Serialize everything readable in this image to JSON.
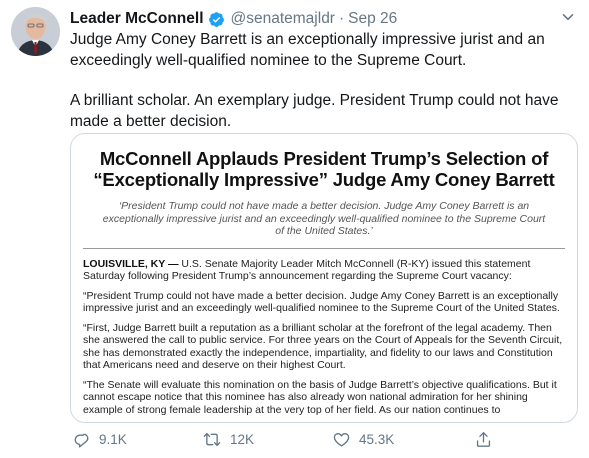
{
  "tweet": {
    "author_name": "Leader McConnell",
    "handle": "@senatemajldr",
    "separator": "·",
    "date": "Sep 26",
    "text_1": "Judge Amy Coney Barrett is an exceptionally impressive jurist and an exceedingly well-qualified nominee to the Supreme Court.",
    "text_2": "A brilliant scholar. An exemplary judge. President Trump could not have made a better decision."
  },
  "media": {
    "title": "McConnell Applauds President Trump’s Selection of “Exceptionally Impressive” Judge Amy Coney Barrett",
    "subtitle": "‘President Trump could not have made a better decision. Judge Amy Coney Barrett is an exceptionally impressive jurist and an exceedingly well-qualified nominee to the Supreme Court of the United States.’",
    "dateline": "LOUISVILLE, KY —",
    "lede": " U.S. Senate Majority Leader Mitch McConnell (R-KY) issued this statement Saturday following President Trump’s announcement regarding the Supreme Court vacancy:",
    "para_1": "“President Trump could not have made a better decision. Judge Amy Coney Barrett is an exceptionally impressive jurist and an exceedingly well-qualified nominee to the Supreme Court of the United States.",
    "para_2": "“First, Judge Barrett built a reputation as a brilliant scholar at the forefront of the legal academy. Then she answered the call to public service. For three years on the Court of Appeals for the Seventh Circuit, she has demonstrated exactly the independence, impartiality, and fidelity to our laws and Constitution that Americans need and deserve on their highest Court.",
    "para_3": "“The Senate will evaluate this nomination on the basis of Judge Barrett’s objective qualifications. But it cannot escape notice that this nominee has also already won national admiration for her shining example of strong female leadership at the very top of her field. As our nation continues to"
  },
  "actions": {
    "reply_count": "9.1K",
    "retweet_count": "12K",
    "like_count": "45.3K"
  },
  "icons": {
    "verified": "verified-badge-icon",
    "caret": "chevron-down-icon",
    "reply": "reply-icon",
    "retweet": "retweet-icon",
    "like": "heart-icon",
    "share": "share-icon"
  },
  "colors": {
    "verified_blue": "#1da1f2",
    "secondary_text": "#657786",
    "border": "#cfd9de"
  }
}
